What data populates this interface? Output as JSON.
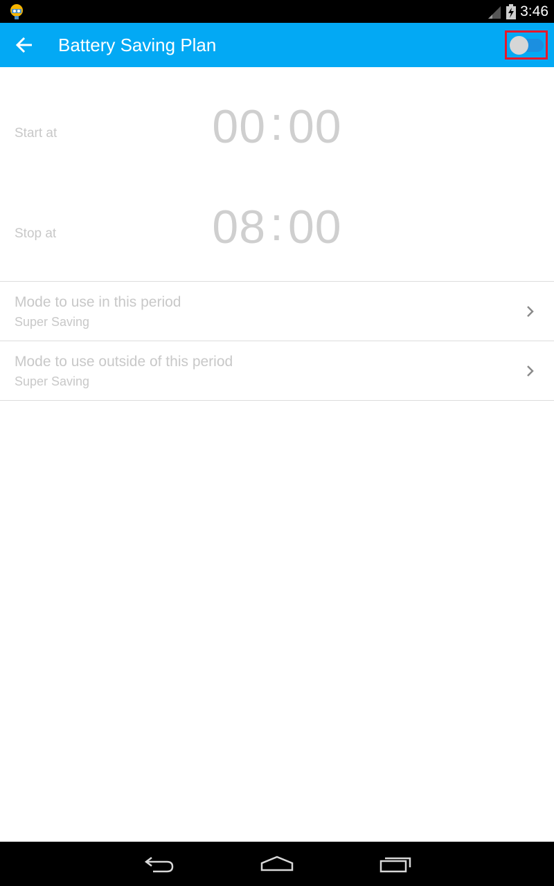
{
  "status_bar": {
    "time": "3:46",
    "icons": [
      "app-notification-icon",
      "signal-icon",
      "battery-charging-icon"
    ]
  },
  "toolbar": {
    "title": "Battery Saving Plan",
    "back_icon": "arrow-left-icon",
    "toggle_state": "on",
    "accent_color": "#03a9f4"
  },
  "schedule": {
    "start": {
      "label": "Start at",
      "hour": "00",
      "minute": "00"
    },
    "stop": {
      "label": "Stop at",
      "hour": "08",
      "minute": "00"
    },
    "separator": ":"
  },
  "modes": [
    {
      "title": "Mode to use in this period",
      "value": "Super Saving"
    },
    {
      "title": "Mode to use outside of this period",
      "value": "Super Saving"
    }
  ],
  "nav_bar": {
    "icons": [
      "back-nav-icon",
      "home-nav-icon",
      "recents-nav-icon"
    ]
  }
}
